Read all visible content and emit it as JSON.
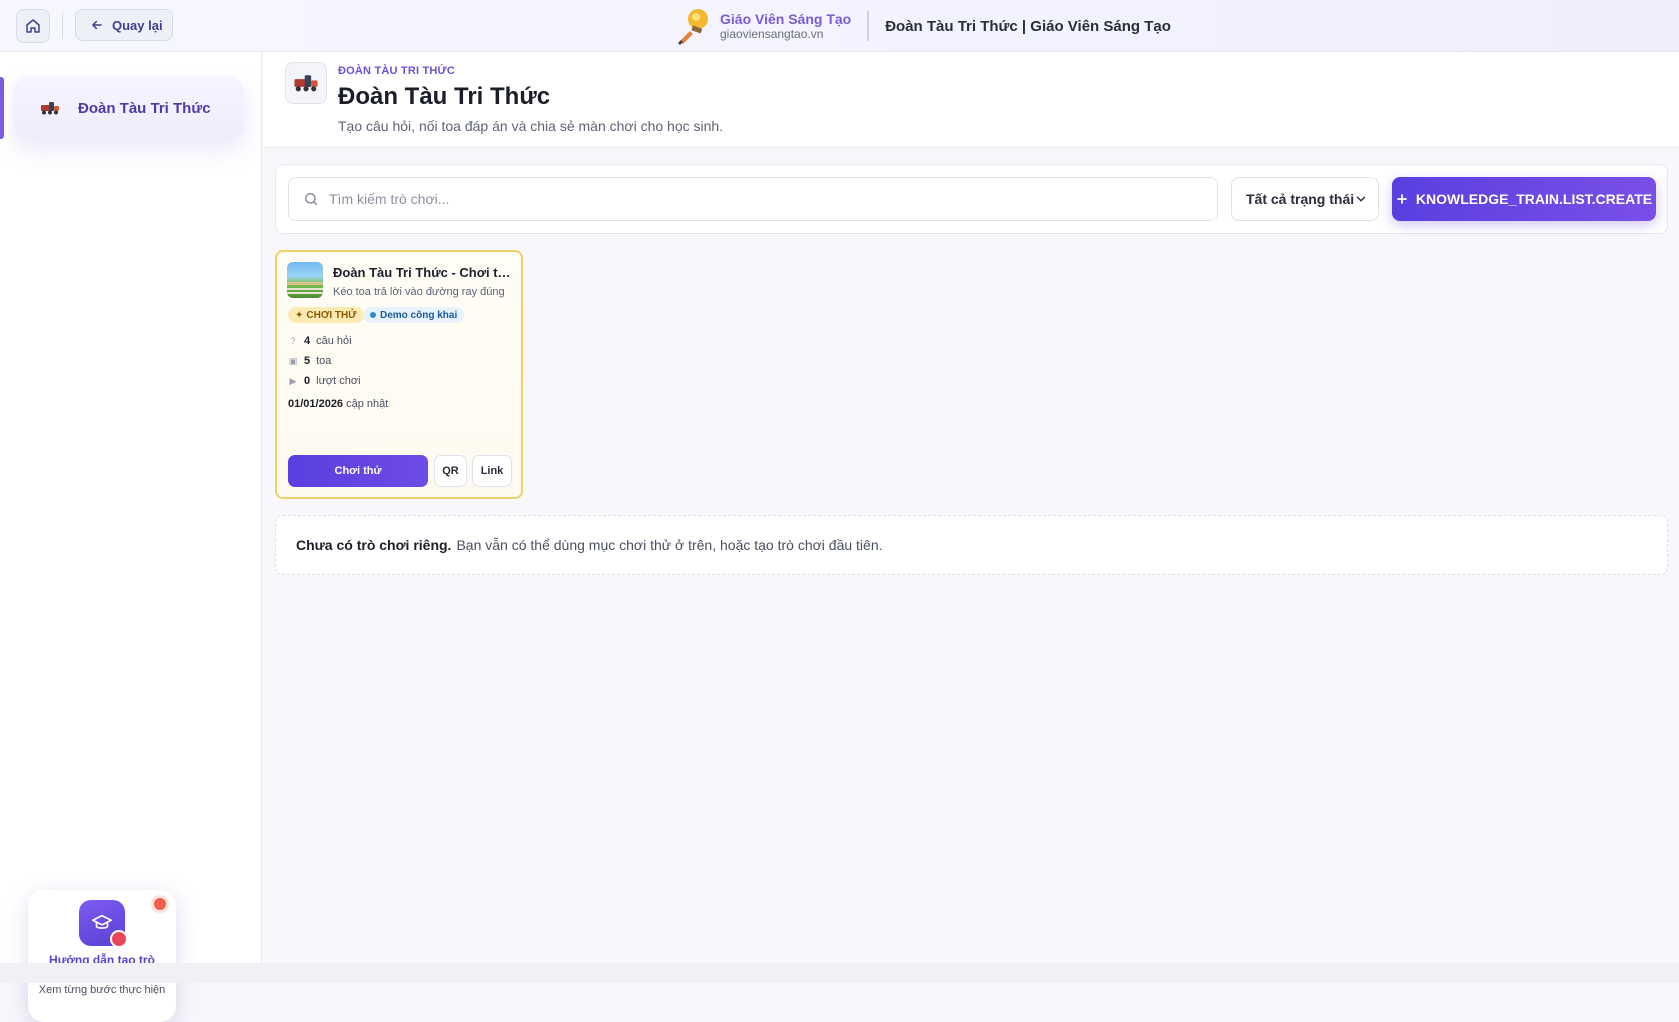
{
  "header": {
    "back_label": "Quay lại",
    "brand_name": "Giáo Viên Sáng Tạo",
    "brand_url": "giaoviensangtao.vn",
    "title": "Đoàn Tàu Tri Thức | Giáo Viên Sáng Tạo"
  },
  "sidebar": {
    "items": [
      {
        "label": "Đoàn Tàu Tri Thức",
        "icon": "train-icon",
        "active": true
      }
    ],
    "guide": {
      "title": "Hướng dẫn tạo trò chơi",
      "subtitle": "Xem từng bước thực hiện"
    }
  },
  "page": {
    "eyebrow": "ĐOÀN TÀU TRI THỨC",
    "title": "Đoàn Tàu Tri Thức",
    "subtitle": "Tạo câu hỏi, nối toa đáp án và chia sẻ màn chơi cho học sinh."
  },
  "toolbar": {
    "search_placeholder": "Tìm kiếm trò chơi...",
    "status_value": "Tất cả trạng thái",
    "create_label": "KNOWLEDGE_TRAIN.LIST.CREATE"
  },
  "cards": [
    {
      "title": "Đoàn Tàu Tri Thức - Chơi thử",
      "description": "Kéo toa trả lời vào đường ray đúng",
      "badge_try": "CHƠI THỬ",
      "badge_demo": "Demo công khai",
      "questions_count": "4",
      "questions_label": "câu hỏi",
      "cars_count": "5",
      "cars_label": "toa",
      "plays_count": "0",
      "plays_label": "lượt chơi",
      "updated_date": "01/01/2026",
      "updated_label": "cập nhật",
      "play_label": "Chơi thử",
      "qr_label": "QR",
      "link_label": "Link"
    }
  ],
  "empty_state": {
    "bold": "Chưa có trò chơi riêng.",
    "text": "Bạn vẫn có thể dùng mục chơi thử ở trên, hoặc tạo trò chơi đầu tiên."
  },
  "colors": {
    "accent": "#5a3fe0",
    "brand": "#7b5ad6",
    "card_border": "#f3cf6a"
  }
}
